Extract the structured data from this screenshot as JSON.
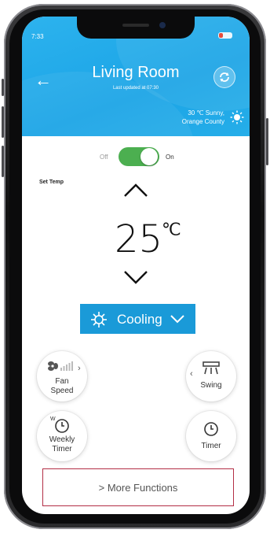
{
  "status_bar": {
    "time": "7:33"
  },
  "header": {
    "title": "Living Room",
    "subtitle": "Last updated at 07:30",
    "weather_line1": "30 ℃ Sunny,",
    "weather_line2": "Orange County"
  },
  "power": {
    "off_label": "Off",
    "on_label": "On",
    "state": "on"
  },
  "temperature": {
    "label": "Set Temp",
    "value": "25",
    "unit": "℃"
  },
  "mode": {
    "label": "Cooling"
  },
  "controls": {
    "fan_speed": "Fan\nSpeed",
    "swing": "Swing",
    "weekly_timer": "Weekly\nTimer",
    "timer": "Timer"
  },
  "more_functions": {
    "label": "More Functions"
  },
  "colors": {
    "header_blue": "#1ba4e6",
    "mode_blue": "#1a9ad8",
    "toggle_green": "#4caf50",
    "more_border": "#b32e45"
  }
}
